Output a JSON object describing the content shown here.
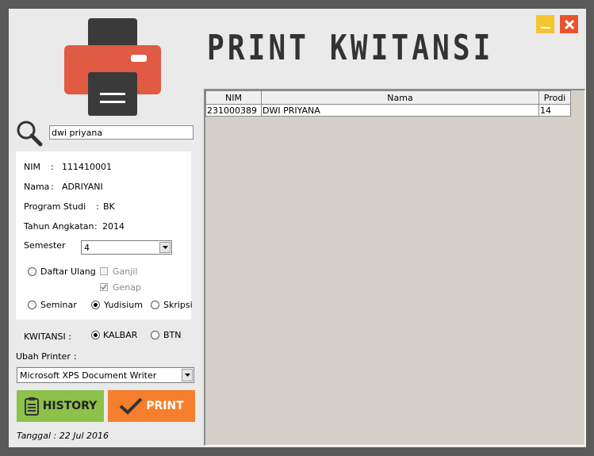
{
  "title": "PRINT KWITANSI",
  "search": {
    "value": "dwi priyana"
  },
  "student": {
    "nim_label": "NIM",
    "nim_sep": ":",
    "nim_value": "111410001",
    "nama_label": "Nama",
    "nama_sep": ":",
    "nama_value": "ADRIYANI",
    "prodi_label": "Program Studi",
    "prodi_sep": ":",
    "prodi_value": "BK",
    "angkatan_label": "Tahun Angkatan",
    "angkatan_sep": ":",
    "angkatan_value": "2014",
    "semester_label": "Semester",
    "semester_value": "4"
  },
  "options": {
    "daftar_ulang": "Daftar Ulang",
    "ganjil": "Ganjil",
    "genap": "Genap",
    "seminar": "Seminar",
    "yudisium": "Yudisium",
    "skripsi": "Skripsi"
  },
  "kwitansi": {
    "label": "KWITANSI :",
    "kalbar": "KALBAR",
    "btn": "BTN"
  },
  "printer": {
    "label": "Ubah Printer",
    "sep": ":",
    "value": "Microsoft XPS Document Writer"
  },
  "buttons": {
    "history": "HISTORY",
    "print": "PRINT"
  },
  "date": "Tanggal :  22 Jul 2016",
  "grid": {
    "headers": [
      "NIM",
      "Nama",
      "Prodi"
    ],
    "rows": [
      [
        "231000389",
        "DWI PRIYANA",
        "14"
      ]
    ]
  },
  "colors": {
    "accent_green": "#8dc14b",
    "accent_orange": "#f57f2d",
    "printer_red": "#e05a44",
    "minimize": "#f5c531",
    "close": "#e8522d"
  }
}
